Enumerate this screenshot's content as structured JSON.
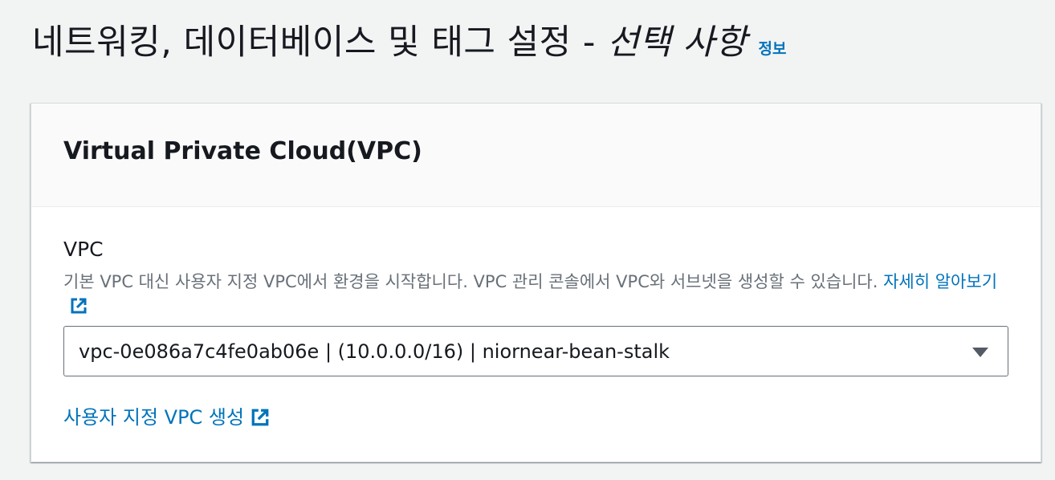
{
  "header": {
    "title": "네트워킹, 데이터베이스 및 태그 설정 - ",
    "title_optional": "선택 사항",
    "info_link": "정보"
  },
  "panel": {
    "title": "Virtual Private Cloud(VPC)",
    "vpc_field": {
      "label": "VPC",
      "description": "기본 VPC 대신 사용자 지정 VPC에서 환경을 시작합니다. VPC 관리 콘솔에서 VPC와 서브넷을 생성할 수 있습니다. ",
      "learn_more": "자세히 알아보기",
      "selected_value": "vpc-0e086a7c4fe0ab06e | (10.0.0.0/16) | niornear-bean-stalk"
    },
    "create_link": "사용자 지정 VPC 생성"
  },
  "colors": {
    "link": "#0073bb",
    "background": "#f2f3f3",
    "text": "#16191f",
    "secondary_text": "#687078"
  },
  "icons": {
    "external_link": "external-link-icon",
    "dropdown": "caret-down-icon"
  }
}
